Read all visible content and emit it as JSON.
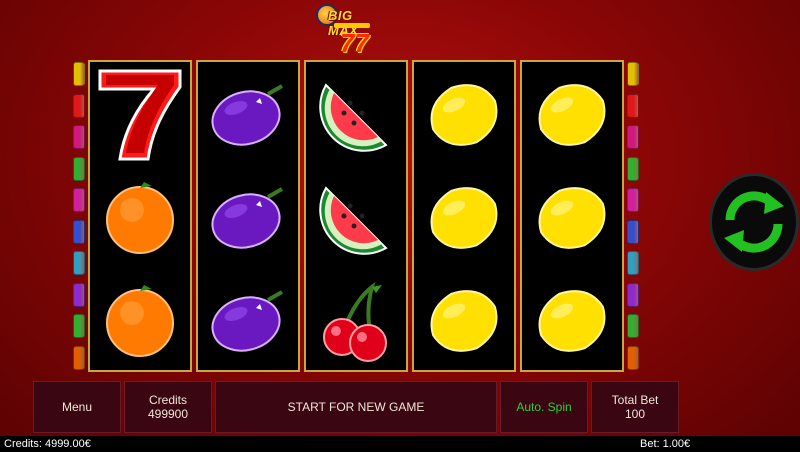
{
  "logo": {
    "line1": "BIG MAX",
    "line2": "77"
  },
  "reels": [
    [
      "seven",
      "orange",
      "orange"
    ],
    [
      "plum",
      "plum",
      "plum"
    ],
    [
      "watermelon",
      "watermelon",
      "cherry"
    ],
    [
      "lemon",
      "lemon",
      "lemon"
    ],
    [
      "lemon",
      "lemon",
      "lemon"
    ]
  ],
  "paylines": {
    "left_colors": [
      "#e0c000",
      "#e01818",
      "#d01880",
      "#30b030",
      "#d020a0",
      "#3050d0",
      "#30a0c0",
      "#8a2ad0",
      "#30b030",
      "#e06000"
    ],
    "right_colors": [
      "#e0c000",
      "#e01818",
      "#d01880",
      "#30b030",
      "#d020a0",
      "#3050d0",
      "#30a0c0",
      "#8a2ad0",
      "#30b030",
      "#e06000"
    ]
  },
  "controls": {
    "menu_label": "Menu",
    "credits_label": "Credits",
    "credits_value": "499900",
    "start_label": "START FOR NEW GAME",
    "autospin_label": "Auto. Spin",
    "autospin_color": "#2fd02f",
    "totalbet_label": "Total Bet",
    "totalbet_value": "100"
  },
  "footer": {
    "credits": "Credits: 4999.00€",
    "bet": "Bet: 1.00€"
  },
  "spin_button": {
    "icon": "refresh-arrows-icon",
    "color": "#22c020"
  }
}
